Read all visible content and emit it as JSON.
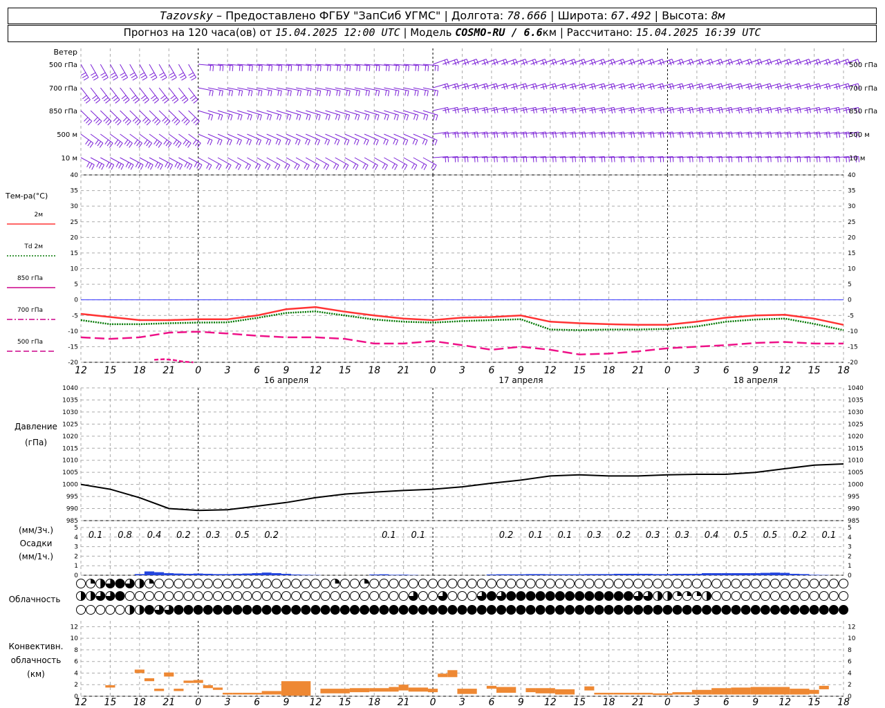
{
  "header": {
    "station": "Tazovsky",
    "dash": "–",
    "provider": "Предоставлено ФГБУ \"ЗапСиб УГМС\"",
    "lon_label": "Долгота:",
    "lon": "78.666",
    "lat_label": "Широта:",
    "lat": "67.492",
    "alt_label": "Высота:",
    "alt": "8м",
    "forecast_prefix": "Прогноз на 120 часа(ов) от",
    "forecast_start": "15.04.2025 12:00 UTC",
    "model_label": "Модель",
    "model": "COSMO-RU / 6.6",
    "model_unit": "км",
    "computed_label": "Рассчитано:",
    "computed": "15.04.2025 16:39 UTC",
    "sep": "|"
  },
  "wind_panel": {
    "title": "Ветер",
    "levels": [
      "500 гПа",
      "700 гПа",
      "850 гПа",
      "500 м",
      "10  м"
    ]
  },
  "temp_panel": {
    "title": "Тем-ра(°C)",
    "legend": [
      {
        "label": "2м",
        "color": "#ff3333",
        "dash": "solid"
      },
      {
        "label": "Td  2м",
        "color": "#007700",
        "dash": "dotted"
      },
      {
        "label": "850 гПа",
        "color": "#cc0088",
        "dash": "solid"
      },
      {
        "label": "700 гПа",
        "color": "#cc0088",
        "dash": "dashdot"
      },
      {
        "label": "500 гПа",
        "color": "#cc0088",
        "dash": "dashed"
      }
    ]
  },
  "pressure_panel": {
    "title": "Давление",
    "unit": "(гПа)"
  },
  "precip_panel": {
    "unit_top": "(мм/3ч.)",
    "title": "Осадки",
    "unit_bottom": "(мм/1ч.)",
    "totals": [
      "0.1",
      "0.8",
      "0.4",
      "0.2",
      "0.3",
      "0.5",
      "0.2",
      "0.1",
      "0.1",
      "0.2",
      "0.1",
      "0.1",
      "0.3",
      "0.2",
      "0.3",
      "0.3",
      "0.4",
      "0.5",
      "0.5",
      "0.2",
      "0.1"
    ],
    "total_slots": [
      1,
      2,
      3,
      4,
      5,
      6,
      7,
      11,
      12,
      15,
      16,
      17,
      18,
      19,
      20,
      21,
      22,
      23,
      24,
      25,
      26
    ]
  },
  "cloud_panel": {
    "title": "Облачность",
    "rows": [
      "0123432100000000000000000010010000000000000000000000000000000000000000000000000002300000121000000000000000002431000000000000000000000",
      "2233400000000000000000000000000000300300034344444444444443322111200000000000000000000000000000000000000000000000000300002300000",
      "0000022433444444444444444444444444444444444444444444444444444444444444444444444444444444444444444444444444444444444444444444"
    ]
  },
  "conv_panel": {
    "title_1": "Конвективн.",
    "title_2": "облачность",
    "unit": "(км)"
  },
  "time_axis": {
    "hour_labels": [
      "12",
      "15",
      "18",
      "21",
      "0",
      "3",
      "6",
      "9",
      "12",
      "15",
      "18",
      "21",
      "0",
      "3",
      "6",
      "9",
      "12",
      "15",
      "18",
      "21",
      "0",
      "3",
      "6",
      "9",
      "12",
      "15",
      "18"
    ],
    "date_labels": [
      "16 апреля",
      "17 апреля",
      "18 апреля"
    ]
  },
  "chart_data": {
    "type": "line",
    "x_unit": "hours since 15.04.2025 12:00 UTC",
    "x_range": [
      0,
      78
    ],
    "temperature": {
      "ylim": [
        -20,
        40
      ],
      "ticks": [
        -20,
        -15,
        -10,
        -5,
        0,
        5,
        10,
        15,
        20,
        25,
        30,
        35,
        40
      ],
      "series": [
        {
          "name": "2м",
          "x": [
            0,
            3,
            6,
            9,
            12,
            15,
            18,
            21,
            24,
            27,
            30,
            33,
            36,
            39,
            42,
            45,
            48,
            51,
            54,
            57,
            60,
            63,
            66,
            69,
            72,
            75,
            78
          ],
          "values": [
            -4.5,
            -5.5,
            -6.5,
            -6.5,
            -6.2,
            -6.2,
            -5.0,
            -3.0,
            -2.3,
            -3.8,
            -5.0,
            -6.0,
            -6.5,
            -5.7,
            -5.5,
            -5.0,
            -7.0,
            -7.5,
            -7.8,
            -8.0,
            -8.0,
            -7.0,
            -5.7,
            -5.0,
            -4.8,
            -6.0,
            -8.0
          ]
        },
        {
          "name": "Td  2м",
          "x": [
            0,
            3,
            6,
            9,
            12,
            15,
            18,
            21,
            24,
            27,
            30,
            33,
            36,
            39,
            42,
            45,
            48,
            51,
            54,
            57,
            60,
            63,
            66,
            69,
            72,
            75,
            78
          ],
          "values": [
            -6.5,
            -7.8,
            -7.8,
            -7.5,
            -7.3,
            -7.2,
            -5.8,
            -4.2,
            -3.7,
            -5.0,
            -6.3,
            -7.0,
            -7.3,
            -6.8,
            -6.5,
            -6.2,
            -9.5,
            -9.7,
            -9.5,
            -9.5,
            -9.3,
            -8.5,
            -7.0,
            -6.3,
            -6.0,
            -7.7,
            -9.7
          ]
        },
        {
          "name": "500 гПа",
          "x": [
            0,
            3,
            6,
            9,
            12,
            15,
            18,
            21,
            24,
            27,
            30,
            33,
            36,
            39,
            42,
            45,
            48,
            51,
            54,
            57,
            60,
            63,
            66,
            69,
            72,
            75,
            78
          ],
          "values": [
            -12.0,
            -12.5,
            -12.0,
            -10.5,
            -10.2,
            -10.8,
            -11.5,
            -12.0,
            -12.0,
            -12.5,
            -14.0,
            -14.0,
            -13.2,
            -14.5,
            -16.0,
            -15.0,
            -16.0,
            -17.5,
            -17.2,
            -16.5,
            -15.5,
            -15.0,
            -14.5,
            -13.8,
            -13.5,
            -14.0,
            -14.0
          ]
        },
        {
          "name": "850 гПа",
          "x": [
            7.5,
            8.5,
            9.5,
            10.5,
            11.5
          ],
          "values": [
            -19.2,
            -19.0,
            -19.3,
            -19.8,
            -20.0
          ]
        }
      ]
    },
    "pressure": {
      "ylim": [
        985,
        1040
      ],
      "ticks": [
        985,
        990,
        995,
        1000,
        1005,
        1010,
        1015,
        1020,
        1025,
        1030,
        1035,
        1040
      ],
      "x": [
        0,
        3,
        6,
        9,
        12,
        15,
        18,
        21,
        24,
        27,
        30,
        33,
        36,
        39,
        42,
        45,
        48,
        51,
        54,
        57,
        60,
        63,
        66,
        69,
        72,
        75,
        78
      ],
      "values": [
        1000.0,
        998.0,
        994.5,
        990.0,
        989.2,
        989.5,
        991.0,
        992.5,
        994.5,
        996.0,
        996.8,
        997.5,
        998.0,
        999.0,
        1000.5,
        1001.8,
        1003.5,
        1004.0,
        1003.5,
        1003.5,
        1004.0,
        1004.2,
        1004.2,
        1005.0,
        1006.5,
        1008.0,
        1008.5
      ]
    },
    "precip": {
      "ylim": [
        0,
        5
      ],
      "ticks": [
        0,
        1,
        2,
        3,
        4,
        5
      ],
      "x": [
        6,
        7,
        8,
        9,
        10,
        11,
        12,
        13,
        14,
        15,
        16,
        17,
        18,
        19,
        20,
        21,
        22,
        23,
        24,
        30,
        31,
        32,
        33,
        34,
        42,
        43,
        44,
        45,
        46,
        47,
        48,
        49,
        50,
        51,
        52,
        53,
        54,
        55,
        56,
        57,
        58,
        59,
        60,
        61,
        62,
        63,
        64,
        65,
        66,
        67,
        68,
        69,
        70,
        71,
        72,
        73,
        74,
        75,
        76
      ],
      "values": [
        0.12,
        0.4,
        0.32,
        0.22,
        0.18,
        0.15,
        0.18,
        0.15,
        0.12,
        0.12,
        0.15,
        0.18,
        0.22,
        0.28,
        0.22,
        0.15,
        0.08,
        0.05,
        0.03,
        0.08,
        0.1,
        0.05,
        0.06,
        0.03,
        0.08,
        0.1,
        0.1,
        0.1,
        0.12,
        0.12,
        0.1,
        0.1,
        0.1,
        0.1,
        0.12,
        0.12,
        0.12,
        0.15,
        0.15,
        0.15,
        0.15,
        0.12,
        0.12,
        0.15,
        0.15,
        0.15,
        0.22,
        0.22,
        0.22,
        0.22,
        0.22,
        0.22,
        0.25,
        0.28,
        0.25,
        0.15,
        0.12,
        0.05,
        0.03
      ]
    },
    "convective": {
      "ylim": [
        0,
        13
      ],
      "ticks": [
        0,
        2,
        4,
        6,
        8,
        10,
        12
      ],
      "bars": [
        [
          2.5,
          3.5,
          1.5,
          1.9
        ],
        [
          5.5,
          6.5,
          4.0,
          4.6
        ],
        [
          6.5,
          7.5,
          2.6,
          3.1
        ],
        [
          7.5,
          8.5,
          0.9,
          1.3
        ],
        [
          8.5,
          9.5,
          3.4,
          4.1
        ],
        [
          9.5,
          10.5,
          0.9,
          1.3
        ],
        [
          10.5,
          11.5,
          2.3,
          2.7
        ],
        [
          11.5,
          12.5,
          2.3,
          2.8
        ],
        [
          12.5,
          13.5,
          1.4,
          1.9
        ],
        [
          13.5,
          14.5,
          1.1,
          1.5
        ],
        [
          14.5,
          15.5,
          0.3,
          0.6
        ],
        [
          15.5,
          16.5,
          0.3,
          0.6
        ],
        [
          16.5,
          17.5,
          0.3,
          0.6
        ],
        [
          17.5,
          18.5,
          0.3,
          0.6
        ],
        [
          18.5,
          20.5,
          0.3,
          0.9
        ],
        [
          20.5,
          23.5,
          0.1,
          2.6
        ],
        [
          24.5,
          27.5,
          0.5,
          1.3
        ],
        [
          27.5,
          29.5,
          0.7,
          1.4
        ],
        [
          29.5,
          31.5,
          0.8,
          1.4
        ],
        [
          31.5,
          32.5,
          0.8,
          1.6
        ],
        [
          32.5,
          33.5,
          1.0,
          2.0
        ],
        [
          33.5,
          35.5,
          0.8,
          1.5
        ],
        [
          35.5,
          36.5,
          0.7,
          1.3
        ],
        [
          36.5,
          37.5,
          3.3,
          3.9
        ],
        [
          37.5,
          38.5,
          3.3,
          4.5
        ],
        [
          38.5,
          40.5,
          0.4,
          1.3
        ],
        [
          41.5,
          42.5,
          1.3,
          1.8
        ],
        [
          42.5,
          44.5,
          0.6,
          1.6
        ],
        [
          45.5,
          46.5,
          0.7,
          1.4
        ],
        [
          46.5,
          48.5,
          0.5,
          1.4
        ],
        [
          48.5,
          50.5,
          0.3,
          1.2
        ],
        [
          51.5,
          52.5,
          1.0,
          1.7
        ],
        [
          52.5,
          54.5,
          0.3,
          0.6
        ],
        [
          54.5,
          56.5,
          0.3,
          0.6
        ],
        [
          56.5,
          58.5,
          0.3,
          0.6
        ],
        [
          58.5,
          60.5,
          0.2,
          0.5
        ],
        [
          60.5,
          62.5,
          0.3,
          0.7
        ],
        [
          62.5,
          64.5,
          0.3,
          1.1
        ],
        [
          64.5,
          66.5,
          0.3,
          1.4
        ],
        [
          66.5,
          68.5,
          0.3,
          1.5
        ],
        [
          68.5,
          70.5,
          0.3,
          1.6
        ],
        [
          70.5,
          72.5,
          0.3,
          1.6
        ],
        [
          72.5,
          74.5,
          0.3,
          1.3
        ],
        [
          74.5,
          75.5,
          0.4,
          1.1
        ],
        [
          75.5,
          76.5,
          1.2,
          1.8
        ]
      ]
    }
  }
}
